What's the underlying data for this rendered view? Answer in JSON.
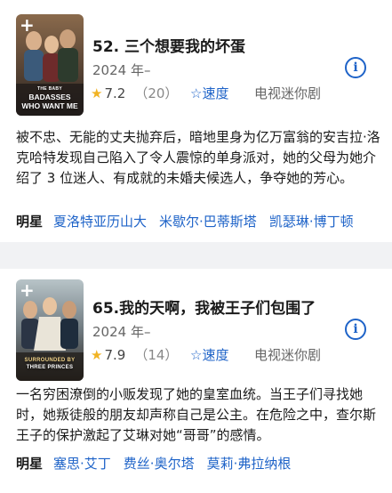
{
  "items": [
    {
      "poster_line1": "THE BABY",
      "poster_line2": "BADASSES",
      "poster_line3": "WHO WANT ME",
      "title": "52. 三个想要我的坏蛋",
      "year": "2024 年–",
      "rating": "7.2",
      "rating_count": "（20）",
      "speed_label": "速度",
      "type": "电视迷你剧",
      "description": "被不忠、无能的丈夫抛弃后，暗地里身为亿万富翁的安吉拉·洛克哈特发现自己陷入了令人震惊的单身派对，她的父母为她介绍了 3 位迷人、有成就的未婚夫候选人，争夺她的芳心。",
      "cast_label": "明星",
      "cast": [
        "夏洛特亚历山大",
        "米歇尔·巴蒂斯塔",
        "凯瑟琳·博丁顿"
      ]
    },
    {
      "poster_line1": "SURROUNDED BY",
      "poster_line2": "THREE PRINCES",
      "poster_line3": "",
      "title": "65.我的天啊，我被王子们包围了",
      "year": "2024 年–",
      "rating": "7.9",
      "rating_count": "（14）",
      "speed_label": "速度",
      "type": "电视迷你剧",
      "description": "一名穷困潦倒的小贩发现了她的皇室血统。当王子们寻找她时，她叛徒般的朋友却声称自己是公主。在危险之中，查尔斯王子的保护激起了艾琳对她“哥哥”的感情。",
      "cast_label": "明星",
      "cast": [
        "塞思·艾丁",
        "费丝·奥尔塔",
        "莫莉·弗拉纳根"
      ]
    }
  ],
  "icons": {
    "add": "plus-icon",
    "info": "info-icon",
    "rating_star": "star-icon",
    "speed_star": "star-outline-icon"
  },
  "colors": {
    "accent": "#1e63c8",
    "star": "#f1b323",
    "separator": "#f1f2f4"
  }
}
